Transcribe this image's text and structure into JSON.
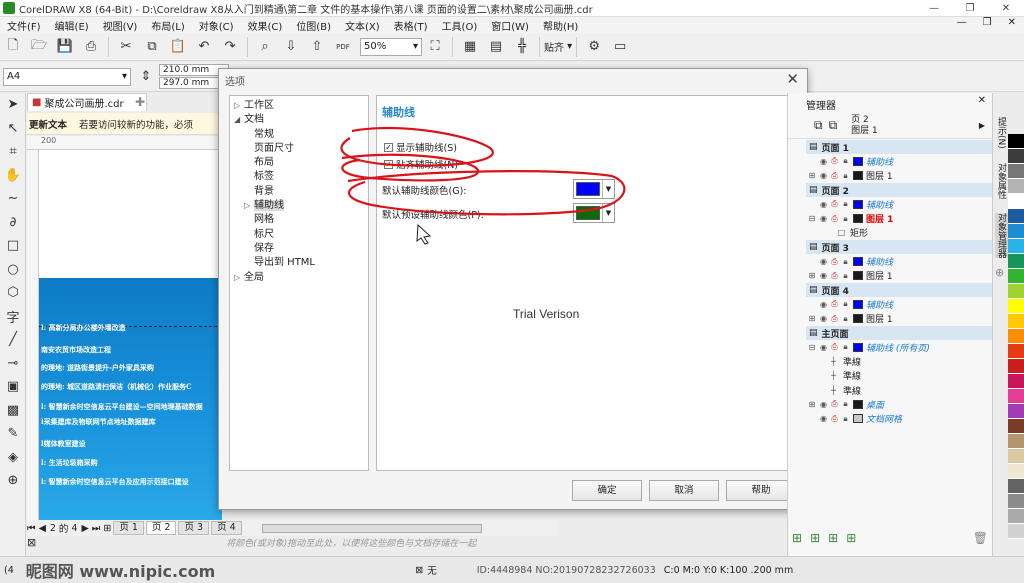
{
  "window": {
    "title": "CorelDRAW X8 (64-Bit) - D:\\Coreldraw X8从入门到精通\\第二章 文件的基本操作\\第八课 页面的设置二\\素材\\聚成公司画册.cdr",
    "controls": [
      "—",
      "❐",
      "✕"
    ]
  },
  "menubar": {
    "items": [
      "文件(F)",
      "编辑(E)",
      "视图(V)",
      "布局(L)",
      "对象(C)",
      "效果(C)",
      "位图(B)",
      "文本(X)",
      "表格(T)",
      "工具(O)",
      "窗口(W)",
      "帮助(H)"
    ],
    "right_controls": [
      "—",
      "❐",
      "✕"
    ]
  },
  "toolbar": {
    "zoom_value": "50%",
    "snap_label": "贴齐"
  },
  "propbar": {
    "paper_size": "A4",
    "width": "210.0 mm",
    "height": "297.0 mm"
  },
  "document": {
    "tab_label": "聚成公司画册.cdr",
    "update_label": "更新文本",
    "update_message": "若要访问较新的功能，必须",
    "ruler_mark": "200",
    "brochure_lines": [
      "l: 高新分局办公楼外墙改造",
      "南安农贸市场改造工程",
      "的理地: 道路街景提升-户外家具采购",
      "的理地: 城区道路清扫保洁（机械化）作业服务C",
      "l: 智慧新余时空信息云平台建设—空间地理基础数据",
      "l采集建库及物联网节点地址数据建库",
      "l媒体教室建设",
      "l: 生活垃圾箱采购",
      "l: 智慧新余时空信息云平台及应用示范接口建设"
    ]
  },
  "pagenav": {
    "current": "2",
    "of_label": "的",
    "total": "4",
    "tabs": [
      "页 1",
      "页 2",
      "页 3",
      "页 4"
    ],
    "hint": "将颜色(或对象)拖动至此处，以便将这些颜色与文档存储在一起"
  },
  "dialog": {
    "title": "选项",
    "close": "✕",
    "tree": [
      {
        "label": "工作区",
        "level": 0,
        "arrow": "▷"
      },
      {
        "label": "文档",
        "level": 0,
        "arrow": "◢"
      },
      {
        "label": "常规",
        "level": 1,
        "arrow": ""
      },
      {
        "label": "页面尺寸",
        "level": 1,
        "arrow": ""
      },
      {
        "label": "布局",
        "level": 1,
        "arrow": ""
      },
      {
        "label": "标签",
        "level": 1,
        "arrow": ""
      },
      {
        "label": "背景",
        "level": 1,
        "arrow": ""
      },
      {
        "label": "辅助线",
        "level": 1,
        "arrow": "▷"
      },
      {
        "label": "网格",
        "level": 1,
        "arrow": ""
      },
      {
        "label": "标尺",
        "level": 1,
        "arrow": ""
      },
      {
        "label": "保存",
        "level": 1,
        "arrow": ""
      },
      {
        "label": "导出到 HTML",
        "level": 1,
        "arrow": ""
      },
      {
        "label": "全局",
        "level": 0,
        "arrow": "▷"
      }
    ],
    "panel_title": "辅助线",
    "show_guides": "显示辅助线(S)",
    "snap_guides": "贴齐辅助线(N)",
    "guide_color_label": "默认辅助线颜色(G):",
    "guide_color": "#0000ff",
    "preset_color_label": "默认预设辅助线颜色(P):",
    "preset_color": "#0a6b0a",
    "watermark": "Trial Verison",
    "buttons": {
      "ok": "确定",
      "cancel": "取消",
      "help": "帮助"
    }
  },
  "objmgr": {
    "title": "管理器",
    "current_page": "页 2",
    "current_layer": "图层 1",
    "rows": [
      {
        "type": "page",
        "label": "页面 1"
      },
      {
        "type": "layer",
        "label": "辅助线",
        "style": "it",
        "color": "#0000ff",
        "exp": ""
      },
      {
        "type": "layer",
        "label": "图层 1",
        "style": "",
        "color": "#1a1a1a",
        "exp": "⊞"
      },
      {
        "type": "page",
        "label": "页面 2"
      },
      {
        "type": "layer",
        "label": "辅助线",
        "style": "it",
        "color": "#0000ff",
        "exp": ""
      },
      {
        "type": "layer",
        "label": "图层 1",
        "style": "red",
        "color": "#1a1a1a",
        "exp": "⊟"
      },
      {
        "type": "object",
        "label": "矩形"
      },
      {
        "type": "page",
        "label": "页面 3"
      },
      {
        "type": "layer",
        "label": "辅助线",
        "style": "it",
        "color": "#0000ff",
        "exp": ""
      },
      {
        "type": "layer",
        "label": "图层 1",
        "style": "",
        "color": "#1a1a1a",
        "exp": "⊞"
      },
      {
        "type": "page",
        "label": "页面 4"
      },
      {
        "type": "layer",
        "label": "辅助线",
        "style": "it",
        "color": "#0000ff",
        "exp": ""
      },
      {
        "type": "layer",
        "label": "图层 1",
        "style": "",
        "color": "#1a1a1a",
        "exp": "⊞"
      },
      {
        "type": "page",
        "label": "主页面"
      },
      {
        "type": "layer",
        "label": "辅助线 (所有页)",
        "style": "it",
        "color": "#0000ff",
        "exp": "⊟"
      },
      {
        "type": "guide",
        "label": "準線"
      },
      {
        "type": "guide",
        "label": "準線"
      },
      {
        "type": "guide",
        "label": "準線"
      },
      {
        "type": "layer",
        "label": "桌面",
        "style": "it",
        "color": "#1a1a1a",
        "exp": "⊞"
      },
      {
        "type": "layer",
        "label": "文档网格",
        "style": "it",
        "color": "#c8c8c8",
        "exp": ""
      }
    ]
  },
  "sidetabs": [
    "提示(N)",
    "对象属性",
    "对象管理器"
  ],
  "palette": [
    "#000000",
    "#3c3c3c",
    "#787878",
    "#b4b4b4",
    "#ffffff",
    "#1e5aa0",
    "#1e8cd2",
    "#28b4e6",
    "#14965a",
    "#32b432",
    "#a0d232",
    "#ffff00",
    "#ffc800",
    "#ff8c00",
    "#e63c14",
    "#c81e1e",
    "#c8145a",
    "#e63c96",
    "#a03cb4",
    "#783c28",
    "#b4966e",
    "#dcc8a0",
    "#f0e6d2",
    "#646464",
    "#8c8c8c",
    "#aaaaaa",
    "#d2d2d2"
  ],
  "status": {
    "left": "(4",
    "fill_label": "无",
    "color_info": "C:0 M:0 Y:0 K:100  .200 mm",
    "watermark_left": "昵图网 www.nipic.com",
    "watermark_right": "ID:4448984 NO:20190728232726033"
  }
}
